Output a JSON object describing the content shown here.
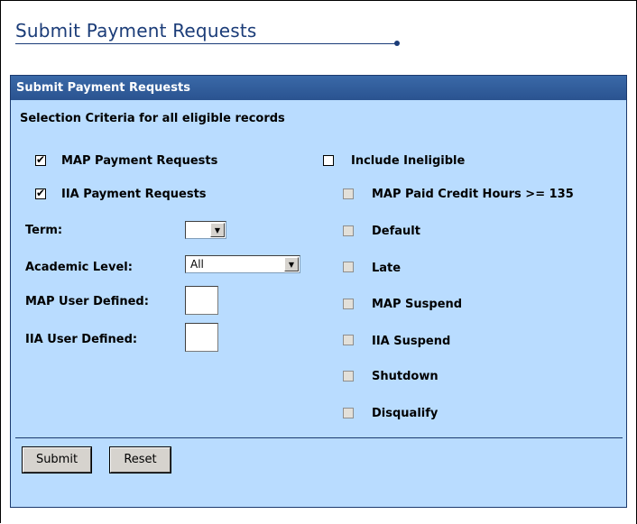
{
  "page": {
    "title": "Submit Payment Requests"
  },
  "panel": {
    "header": "Submit Payment Requests",
    "criteria_label": "Selection Criteria for all eligible records"
  },
  "left": {
    "map_requests": {
      "label": "MAP Payment Requests",
      "checked": true
    },
    "iia_requests": {
      "label": "IIA Payment Requests",
      "checked": true
    },
    "term": {
      "label": "Term:",
      "value": ""
    },
    "academic_level": {
      "label": "Academic Level:",
      "value": "All"
    },
    "map_user_defined": {
      "label": "MAP User Defined:",
      "value": ""
    },
    "iia_user_defined": {
      "label": "IIA User Defined:",
      "value": ""
    }
  },
  "right": {
    "include_ineligible": {
      "label": "Include Ineligible",
      "checked": false
    },
    "options": [
      {
        "label": "MAP Paid Credit Hours >= 135",
        "checked": false,
        "enabled": false
      },
      {
        "label": "Default",
        "checked": false,
        "enabled": false
      },
      {
        "label": "Late",
        "checked": false,
        "enabled": false
      },
      {
        "label": "MAP Suspend",
        "checked": false,
        "enabled": false
      },
      {
        "label": "IIA Suspend",
        "checked": false,
        "enabled": false
      },
      {
        "label": "Shutdown",
        "checked": false,
        "enabled": false
      },
      {
        "label": "Disqualify",
        "checked": false,
        "enabled": false
      }
    ]
  },
  "buttons": {
    "submit": "Submit",
    "reset": "Reset"
  },
  "icons": {
    "dropdown": "chevron-down-icon",
    "check": "checkmark-icon"
  },
  "colors": {
    "title": "#1b3c78",
    "panel_bg": "#b9dcff",
    "header_bg": "#2f5c99"
  }
}
